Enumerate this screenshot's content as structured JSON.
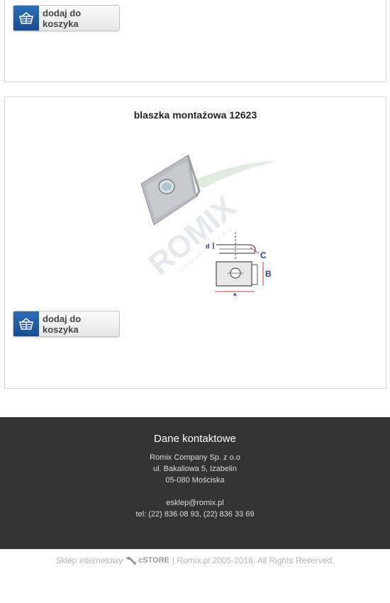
{
  "cards": [
    {
      "add_to_cart_label": "dodaj do koszyka"
    },
    {
      "title": "blaszka montażowa 12623",
      "add_to_cart_label": "dodaj do koszyka",
      "image_labels": {
        "d": "d",
        "c": "C",
        "b": "B",
        "a": "A"
      },
      "watermark": "ROMIX",
      "watermark_sub": "COMPANY SP. Z O.O."
    }
  ],
  "footer": {
    "heading": "Dane kontaktowe",
    "company": "Romix Company Sp. z o.o",
    "street": "ul. Bakaliowa 5, Izabelin",
    "city": "05-080 Mościska",
    "email": "esklep@romix.pl",
    "phone": "tel: (22) 836 08 93, (22) 836 33 69"
  },
  "bottom": {
    "prefix": "Sklep internetowy",
    "logo_text": "cSTORE",
    "suffix": "| Romix.pl 2005-2016. All Rights Reserved."
  },
  "colors": {
    "accent": "#1f5aa0",
    "footer_bg": "#333333"
  },
  "icons": {
    "cart": "basket-icon"
  }
}
